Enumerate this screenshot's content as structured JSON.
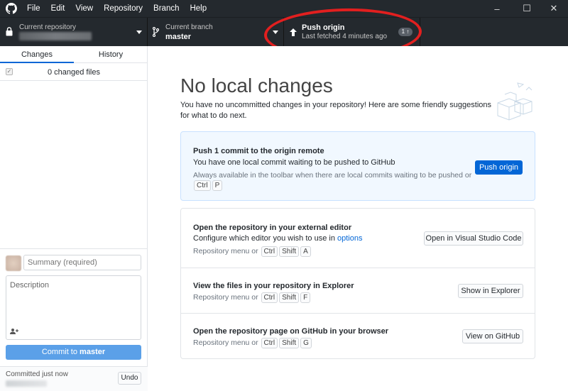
{
  "menu": [
    "File",
    "Edit",
    "View",
    "Repository",
    "Branch",
    "Help"
  ],
  "window_controls": [
    "–",
    "☐",
    "✕"
  ],
  "toolbar": {
    "repo_title": "Current repository",
    "branch_title": "Current branch",
    "branch_value": "master",
    "push_title": "Push origin",
    "push_subtitle": "Last fetched 4 minutes ago",
    "push_badge": "1 ↑"
  },
  "sidebar": {
    "tabs": [
      "Changes",
      "History"
    ],
    "changed_files": "0 changed files",
    "summary_placeholder": "Summary (required)",
    "description_placeholder": "Description",
    "coauthor_icon": "+",
    "commit_label_prefix": "Commit to",
    "commit_branch": "master",
    "last_commit": "Committed just now",
    "undo": "Undo"
  },
  "main": {
    "heading": "No local changes",
    "intro": "You have no uncommitted changes in your repository! Here are some friendly suggestions for what to do next.",
    "push_card": {
      "title": "Push 1 commit to the origin remote",
      "desc": "You have one local commit waiting to be pushed to GitHub",
      "hint": "Always available in the toolbar when there are local commits waiting to be pushed or",
      "keys": [
        "Ctrl",
        "P"
      ],
      "button": "Push origin"
    },
    "actions": [
      {
        "title": "Open the repository in your external editor",
        "desc_prefix": "Configure which editor you wish to use in",
        "desc_link": "options",
        "hint_prefix": "Repository menu or",
        "keys": [
          "Ctrl",
          "Shift",
          "A"
        ],
        "button": "Open in Visual Studio Code"
      },
      {
        "title": "View the files in your repository in Explorer",
        "hint_prefix": "Repository menu or",
        "keys": [
          "Ctrl",
          "Shift",
          "F"
        ],
        "button": "Show in Explorer"
      },
      {
        "title": "Open the repository page on GitHub in your browser",
        "hint_prefix": "Repository menu or",
        "keys": [
          "Ctrl",
          "Shift",
          "G"
        ],
        "button": "View on GitHub"
      }
    ]
  },
  "colors": {
    "toolbar_bg": "#24292e",
    "accent": "#0366d6",
    "commit_button": "#5ba0e8",
    "annotation_red": "#e21f1f"
  }
}
